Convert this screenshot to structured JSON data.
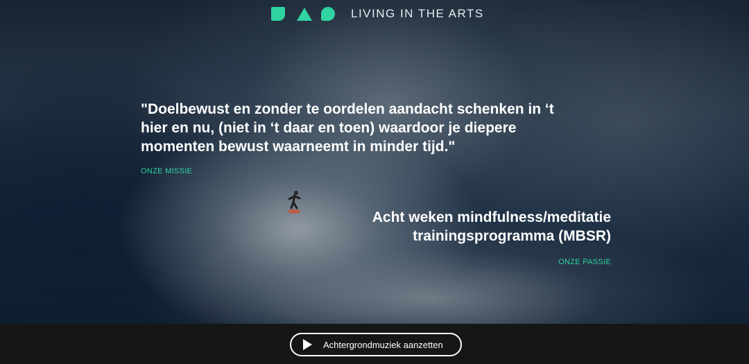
{
  "brand": {
    "name": "LIVING IN THE ARTS",
    "accent_color": "#2fd4a0",
    "logo_icons": [
      "square-shape-icon",
      "triangle-shape-icon",
      "circle-shape-icon"
    ]
  },
  "hero": {
    "quote": "\"Doelbewust en zonder te oordelen aandacht schenken in ‘t hier en nu, (niet in ‘t daar en toen) waardoor je diepere momenten bewust waarneemt in minder tijd.\"",
    "quote_tag": "ONZE MISSIE",
    "headline": "Acht weken mindfulness/meditatie trainingsprogramma (MBSR)",
    "headline_tag": "ONZE PASSIE"
  },
  "footer": {
    "music_button_label": "Achtergrondmuziek aanzetten",
    "music_button_icon": "play-icon"
  }
}
